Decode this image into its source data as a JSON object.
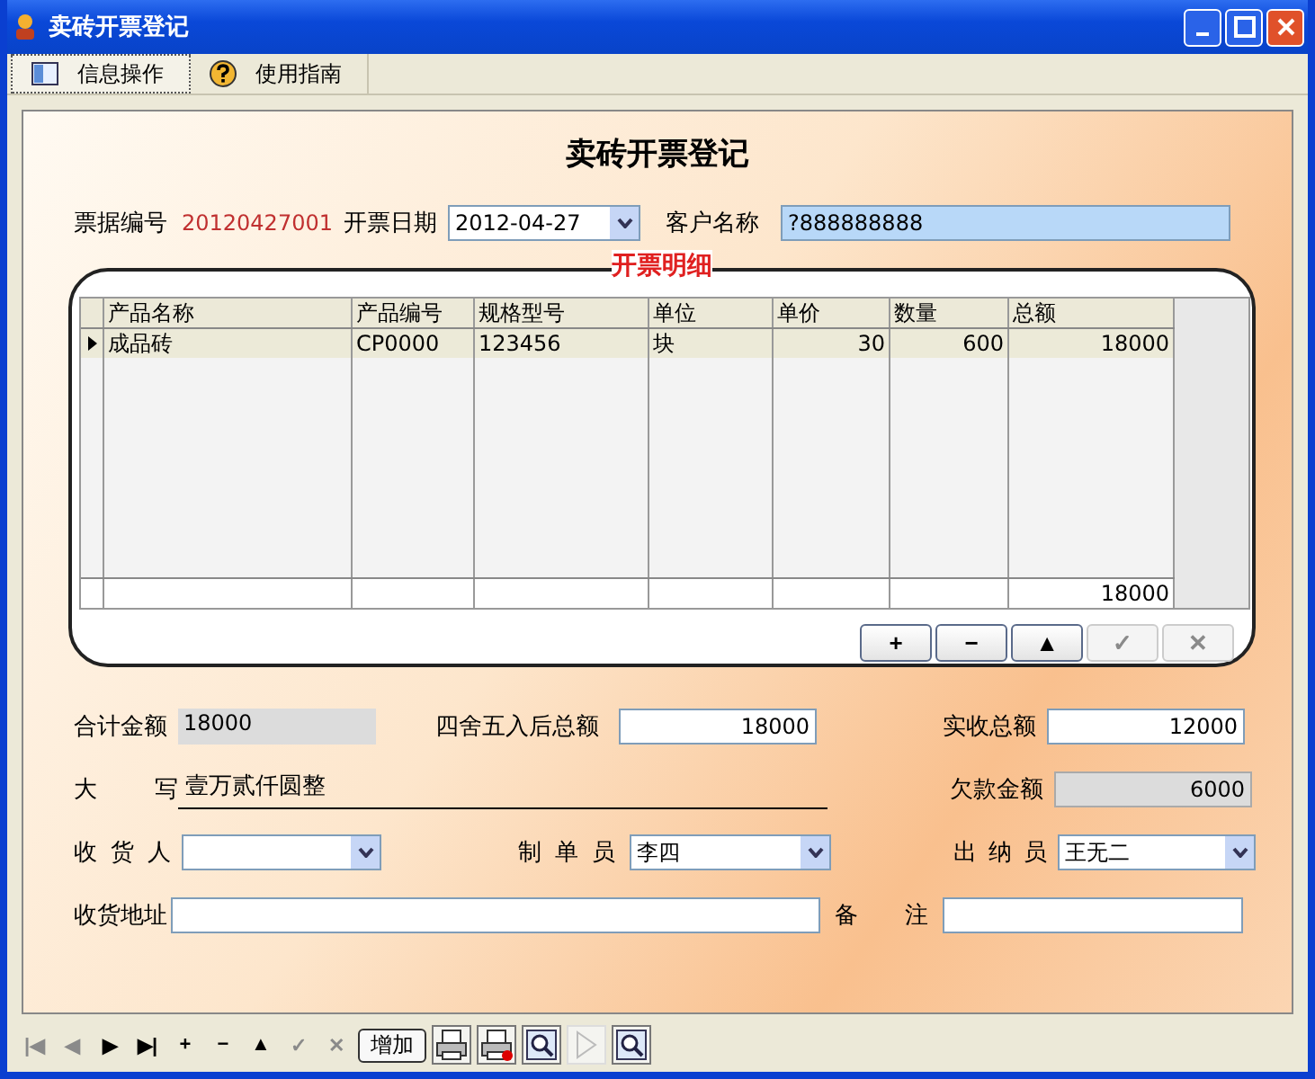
{
  "window": {
    "title": "卖砖开票登记"
  },
  "tabs": [
    {
      "label": "信息操作",
      "selected": true,
      "kind": "info"
    },
    {
      "label": "使用指南",
      "selected": false,
      "kind": "help"
    }
  ],
  "form": {
    "title": "卖砖开票登记",
    "invoice_no": {
      "label": "票据编号",
      "value": "20120427001"
    },
    "invoice_date": {
      "label": "开票日期",
      "value": "2012-04-27"
    },
    "customer": {
      "label": "客户名称",
      "value": "?888888888"
    }
  },
  "details": {
    "title": "开票明细",
    "columns": [
      "产品名称",
      "产品编号",
      "规格型号",
      "单位",
      "单价",
      "数量",
      "总额"
    ],
    "rows": [
      {
        "cells": [
          "成品砖",
          "CP0000",
          "123456",
          "块",
          "30",
          "600",
          "18000"
        ],
        "selected": true
      }
    ],
    "footer_total": "18000",
    "buttons": [
      {
        "label": "+",
        "disabled": false
      },
      {
        "label": "−",
        "disabled": false
      },
      {
        "label": "▲",
        "disabled": false
      },
      {
        "label": "✓",
        "disabled": true
      },
      {
        "label": "✕",
        "disabled": true
      }
    ]
  },
  "totals": {
    "sum": {
      "label": "合计金额",
      "value": "18000"
    },
    "rounded": {
      "label": "四舍五入后总额",
      "value": "18000"
    },
    "received": {
      "label": "实收总额",
      "value": "12000"
    },
    "capital": {
      "label": "大 写",
      "value": "壹万贰仟圆整"
    },
    "owed": {
      "label": "欠款金额",
      "value": "6000"
    }
  },
  "people": {
    "receiver": {
      "label": "收 货 人"
    },
    "maker": {
      "label": "制 单 员",
      "value": "李四"
    },
    "cashier": {
      "label": "出 纳 员",
      "value": "王无二"
    },
    "address": {
      "label": "收货地址"
    },
    "note": {
      "label": "备 注"
    }
  },
  "navigator": [
    {
      "kind": "glyph",
      "label": "|◀",
      "disabled": true
    },
    {
      "kind": "glyph",
      "label": "◀",
      "disabled": true
    },
    {
      "kind": "glyph",
      "label": "▶",
      "disabled": false
    },
    {
      "kind": "glyph",
      "label": "▶|",
      "disabled": false
    },
    {
      "kind": "glyph",
      "label": "+",
      "disabled": false
    },
    {
      "kind": "glyph",
      "label": "−",
      "disabled": false
    },
    {
      "kind": "glyph",
      "label": "▲",
      "disabled": false
    },
    {
      "kind": "glyph",
      "label": "✓",
      "disabled": true
    },
    {
      "kind": "glyph",
      "label": "✕",
      "disabled": true
    },
    {
      "kind": "text",
      "label": "增加",
      "disabled": false
    },
    {
      "kind": "print"
    },
    {
      "kind": "print-delete"
    },
    {
      "kind": "preview"
    },
    {
      "kind": "play",
      "disabled": true
    },
    {
      "kind": "search"
    }
  ]
}
